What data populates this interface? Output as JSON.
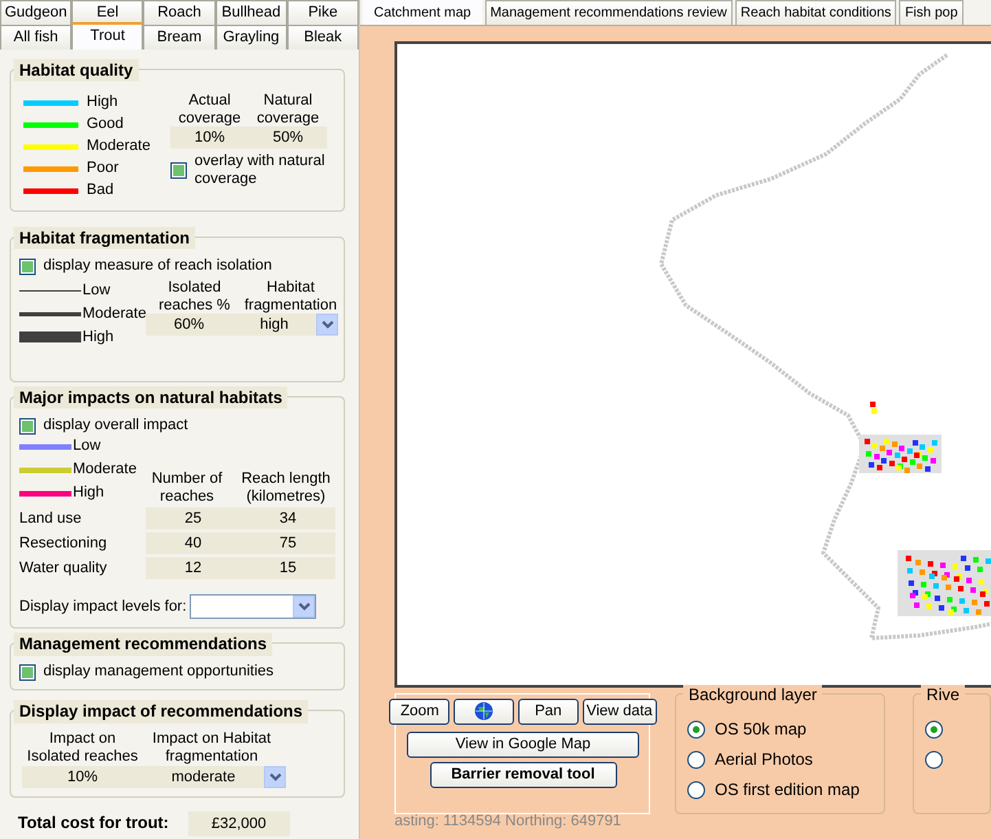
{
  "fish_tabs": [
    {
      "tabs": [
        {
          "label": "Gudgeon",
          "selected": false
        },
        {
          "label": "Eel",
          "selected": false
        },
        {
          "label": "Roach",
          "selected": false
        },
        {
          "label": "Bullhead",
          "selected": false
        },
        {
          "label": "Pike",
          "selected": false
        }
      ]
    },
    {
      "tabs": [
        {
          "label": "All fish",
          "selected": false
        },
        {
          "label": "Trout",
          "selected": true
        },
        {
          "label": "Bream",
          "selected": false
        },
        {
          "label": "Grayling",
          "selected": false
        },
        {
          "label": "Bleak",
          "selected": false
        }
      ]
    }
  ],
  "habitat_quality": {
    "title": "Habitat quality",
    "legend": [
      {
        "label": "High",
        "color": "#00ccff"
      },
      {
        "label": "Good",
        "color": "#00ff00"
      },
      {
        "label": "Moderate",
        "color": "#ffff00"
      },
      {
        "label": "Poor",
        "color": "#ff9900"
      },
      {
        "label": "Bad",
        "color": "#ff0000"
      }
    ],
    "columns": [
      "Actual coverage",
      "Natural coverage"
    ],
    "values": [
      "10%",
      "50%"
    ],
    "overlay": {
      "label": "overlay with natural coverage",
      "checked": true
    }
  },
  "habitat_fragmentation": {
    "title": "Habitat fragmentation",
    "checkbox": {
      "label": "display measure of reach isolation",
      "checked": true
    },
    "legend": [
      {
        "label": "Low",
        "kind": "thin"
      },
      {
        "label": "Moderate",
        "kind": "medium"
      },
      {
        "label": "High",
        "kind": "thick"
      }
    ],
    "columns": [
      "Isolated reaches %",
      "Habitat fragmentation"
    ],
    "values": [
      "60%",
      "high"
    ]
  },
  "major_impacts": {
    "title": "Major impacts on natural habitats",
    "checkbox": {
      "label": "display overall impact",
      "checked": true
    },
    "legend": [
      {
        "label": "Low",
        "color": "#8080ff"
      },
      {
        "label": "Moderate",
        "color": "#cccc33"
      },
      {
        "label": "High",
        "color": "#ff0080"
      }
    ],
    "columns": [
      "Number of reaches",
      "Reach length (kilometres)"
    ],
    "rows": [
      {
        "label": "Land use",
        "values": [
          "25",
          "34"
        ]
      },
      {
        "label": "Resectioning",
        "values": [
          "40",
          "75"
        ]
      },
      {
        "label": "Water quality",
        "values": [
          "12",
          "15"
        ]
      }
    ],
    "select_label": "Display impact levels for:"
  },
  "management": {
    "title": "Management recommendations",
    "checkbox": {
      "label": "display management opportunities",
      "checked": true
    }
  },
  "recommendation_impact": {
    "title": "Display impact of  recommendations",
    "columns": [
      "Impact on Isolated reaches",
      "Impact on Habitat fragmentation"
    ],
    "values": [
      "10%",
      "moderate"
    ]
  },
  "total_cost": {
    "label": "Total cost for trout:",
    "value": "£32,000"
  },
  "map_tabs": [
    {
      "label": "Catchment map",
      "selected": true
    },
    {
      "label": "Management recommendations review",
      "selected": false
    },
    {
      "label": "Reach habitat conditions",
      "selected": false
    },
    {
      "label": "Fish pop",
      "selected": false
    }
  ],
  "map_tools": {
    "buttons": [
      {
        "kind": "text",
        "label": "Zoom"
      },
      {
        "kind": "globe"
      },
      {
        "kind": "text",
        "label": "Pan"
      },
      {
        "kind": "text",
        "label": "View data"
      }
    ],
    "google_button": "View in Google Map",
    "barrier_button": "Barrier removal tool"
  },
  "background_layer": {
    "title": "Background layer",
    "options": [
      {
        "label": "OS 50k map",
        "selected": true
      },
      {
        "label": "Aerial Photos",
        "selected": false
      },
      {
        "label": "OS first edition map",
        "selected": false
      }
    ]
  },
  "river_layer": {
    "title": "Rive",
    "options": [
      {
        "selected": true
      },
      {
        "selected": false
      }
    ]
  },
  "status": "asting: 1134594   Northing: 649791"
}
